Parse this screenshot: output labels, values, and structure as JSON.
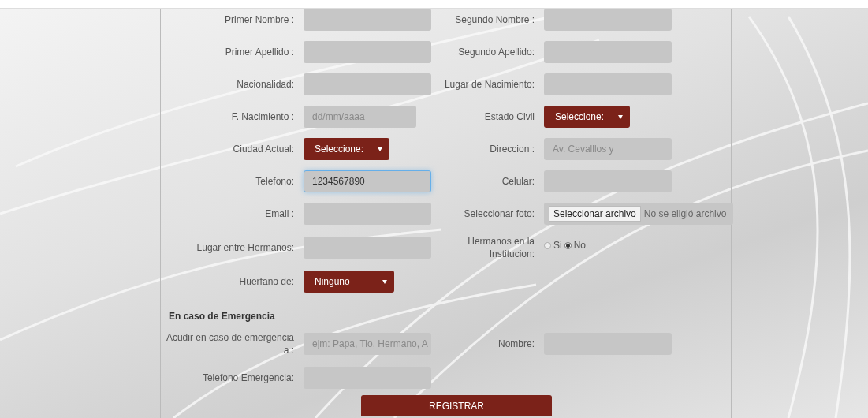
{
  "rows": [
    {
      "cells": [
        {
          "label": "Primer Nombre :",
          "kind": "text",
          "focused": false
        },
        {
          "label": "Segundo Nombre :",
          "kind": "text",
          "focused": false
        }
      ]
    },
    {
      "cells": [
        {
          "label": "Primer Apellido :",
          "kind": "text",
          "focused": false
        },
        {
          "label": "Segundo Apellido:",
          "kind": "text",
          "focused": false
        }
      ]
    },
    {
      "cells": [
        {
          "label": "Nacionalidad:",
          "kind": "text",
          "focused": false
        },
        {
          "label": "Lugar de Nacimiento:",
          "kind": "text",
          "focused": false
        }
      ]
    },
    {
      "cells": [
        {
          "label": "F. Nacimiento :",
          "kind": "date",
          "placeholder": "dd/mm/aaaa"
        },
        {
          "label": "Estado Civil",
          "kind": "select",
          "value": "Seleccione:"
        }
      ]
    },
    {
      "cells": [
        {
          "label": "Ciudad Actual:",
          "kind": "select",
          "value": "Seleccione:"
        },
        {
          "label": "Direccion :",
          "kind": "text",
          "placeholder": "Av. Cevalllos y",
          "focused": false
        }
      ]
    },
    {
      "cells": [
        {
          "label": "Telefono:",
          "kind": "text",
          "value": "1234567890",
          "focused": true
        },
        {
          "label": "Celular:",
          "kind": "text",
          "focused": false
        }
      ]
    },
    {
      "cells": [
        {
          "label": "Email :",
          "kind": "text",
          "focused": false
        },
        {
          "label": "Seleccionar foto:",
          "kind": "file",
          "button_label": "Seleccionar archivo",
          "status": "No se eligió archivo"
        }
      ]
    },
    {
      "cells": [
        {
          "label": "Lugar entre Hermanos:",
          "kind": "text",
          "focused": false
        },
        {
          "label": "Hermanos en la Institucion:",
          "kind": "radio",
          "options": [
            {
              "label": "Si",
              "selected": false
            },
            {
              "label": "No",
              "selected": true
            }
          ]
        }
      ]
    },
    {
      "cells": [
        {
          "label": "Huerfano de:",
          "kind": "select",
          "value": "Ninguno"
        }
      ]
    }
  ],
  "emergency_heading": "En caso de Emergencia",
  "emergency_rows": [
    {
      "cells": [
        {
          "label": "Acudir en caso de emergencia a :",
          "kind": "text",
          "placeholder": "ejm: Papa, Tio, Hermano, A",
          "focused": false
        },
        {
          "label": "Nombre:",
          "kind": "text",
          "focused": false
        }
      ]
    },
    {
      "cells": [
        {
          "label": "Telefono Emergencia:",
          "kind": "text",
          "focused": false
        }
      ]
    }
  ],
  "submit_button": "REGISTRAR"
}
